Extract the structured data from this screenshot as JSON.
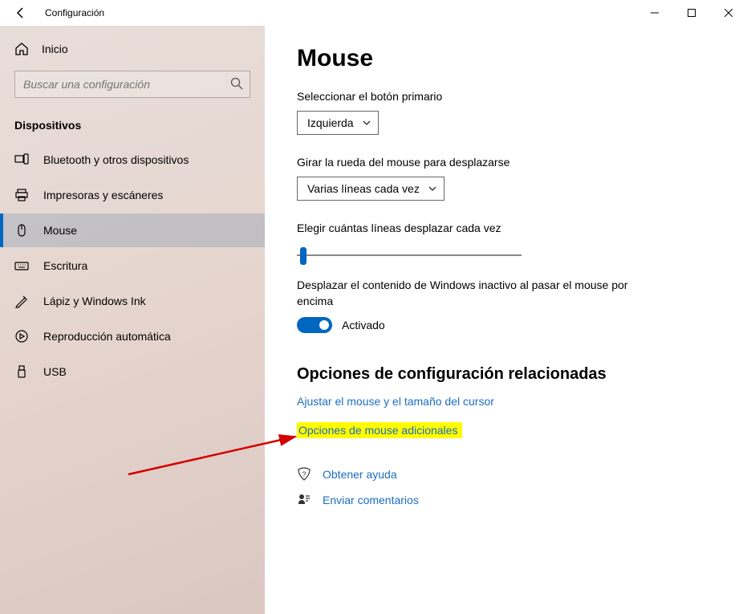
{
  "titlebar": {
    "app_title": "Configuración"
  },
  "sidebar": {
    "home": "Inicio",
    "search_placeholder": "Buscar una configuración",
    "section": "Dispositivos",
    "items": [
      {
        "label": "Bluetooth y otros dispositivos"
      },
      {
        "label": "Impresoras y escáneres"
      },
      {
        "label": "Mouse"
      },
      {
        "label": "Escritura"
      },
      {
        "label": "Lápiz y Windows Ink"
      },
      {
        "label": "Reproducción automática"
      },
      {
        "label": "USB"
      }
    ]
  },
  "main": {
    "title": "Mouse",
    "primary_button_label": "Seleccionar el botón primario",
    "primary_button_value": "Izquierda",
    "scroll_label": "Girar la rueda del mouse para desplazarse",
    "scroll_value": "Varias líneas cada vez",
    "lines_label": "Elegir cuántas líneas desplazar cada vez",
    "inactive_label": "Desplazar el contenido de Windows inactivo al pasar el mouse por encima",
    "toggle_state": "Activado",
    "related_heading": "Opciones de configuración relacionadas",
    "link_cursor": "Ajustar el mouse y el tamaño del cursor",
    "link_additional": "Opciones de mouse adicionales",
    "help": "Obtener ayuda",
    "feedback": "Enviar comentarios"
  }
}
